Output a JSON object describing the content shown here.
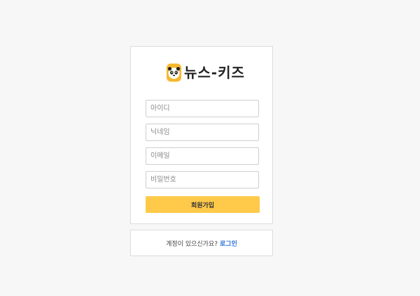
{
  "brand": {
    "name": "뉴스-키즈",
    "icon": "panda-icon",
    "color": "#f5b82e"
  },
  "form": {
    "fields": [
      {
        "placeholder": "아이디",
        "value": ""
      },
      {
        "placeholder": "닉네임",
        "value": ""
      },
      {
        "placeholder": "이메일",
        "value": ""
      },
      {
        "placeholder": "비밀번호",
        "value": ""
      }
    ],
    "submit_label": "회원가입",
    "submit_color": "#ffc94a"
  },
  "footer": {
    "prompt": "계정이 있으신가요?",
    "login_label": "로그인",
    "link_color": "#2f6fd6"
  }
}
